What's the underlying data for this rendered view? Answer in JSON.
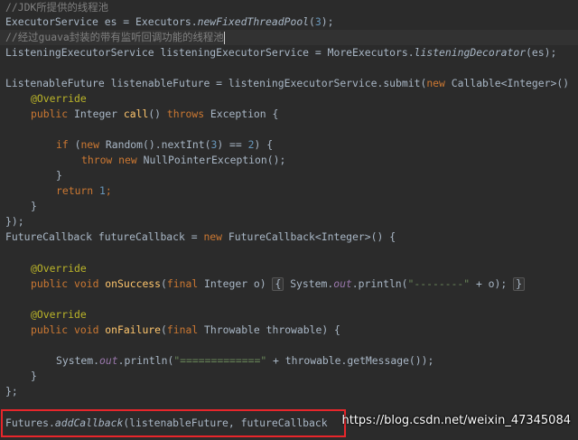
{
  "code": {
    "l1": {
      "comment": "//JDK所提供的线程池"
    },
    "l2": {
      "a": "ExecutorService es = Executors.",
      "b": "newFixedThreadPool",
      "c": "(",
      "d": "3",
      "e": ");"
    },
    "l3": {
      "comment": "//经过guava封装的带有监听回调功能的线程池"
    },
    "l4": {
      "a": "ListeningExecutorService listeningExecutorService = MoreExecutors.",
      "b": "listeningDecorator",
      "c": "(es);"
    },
    "l6": {
      "a": "ListenableFuture listenableFuture = listeningExecutorService.submit(",
      "b": "new",
      "c": " Callable<Integer>()"
    },
    "l7": {
      "ann": "@Override"
    },
    "l8": {
      "a": "public",
      "b": " Integer ",
      "c": "call",
      "d": "() ",
      "e": "throws",
      "f": " Exception {"
    },
    "l10": {
      "a": "if",
      "b": " (",
      "c": "new",
      "d": " Random().nextInt(",
      "e": "3",
      "f": ") == ",
      "g": "2",
      "h": ") {"
    },
    "l11": {
      "a": "throw new",
      "b": " NullPointerException();"
    },
    "l12": {
      "a": "}"
    },
    "l13": {
      "a": "return",
      "b": " ",
      "c": "1",
      "d": ";"
    },
    "l14": {
      "a": "}"
    },
    "l15": {
      "a": "});"
    },
    "l16": {
      "a": "FutureCallback futureCallback = ",
      "b": "new",
      "c": " FutureCallback<Integer>() {"
    },
    "l18": {
      "ann": "@Override"
    },
    "l19": {
      "a": "public void",
      "b": " ",
      "c": "onSuccess",
      "d": "(",
      "e": "final",
      "f": " Integer o) ",
      "g": "{",
      "h": " System.",
      "i": "out",
      "j": ".println(",
      "k": "\"--------\"",
      "l": " + o); ",
      "m": "}"
    },
    "l21": {
      "ann": "@Override"
    },
    "l22": {
      "a": "public void",
      "b": " ",
      "c": "onFailure",
      "d": "(",
      "e": "final",
      "f": " Throwable throwable) {"
    },
    "l24": {
      "a": "System.",
      "b": "out",
      "c": ".println(",
      "d": "\"=============\"",
      "e": " + throwable.getMessage());"
    },
    "l25": {
      "a": "}"
    },
    "l26": {
      "a": "};"
    },
    "l28": {
      "a": "Futures.",
      "b": "addCallback",
      "c": "(listenableFuture, futureCallback"
    }
  },
  "watermark": "https://blog.csdn.net/weixin_47345084",
  "colors": {
    "background": "#2b2b2b",
    "keyword": "#cc7832",
    "comment": "#808080",
    "annotation": "#bbb529",
    "method": "#ffc66d",
    "number": "#6897bb",
    "string": "#6a8759",
    "field": "#9876aa",
    "highlight_box": "#e8262b"
  }
}
